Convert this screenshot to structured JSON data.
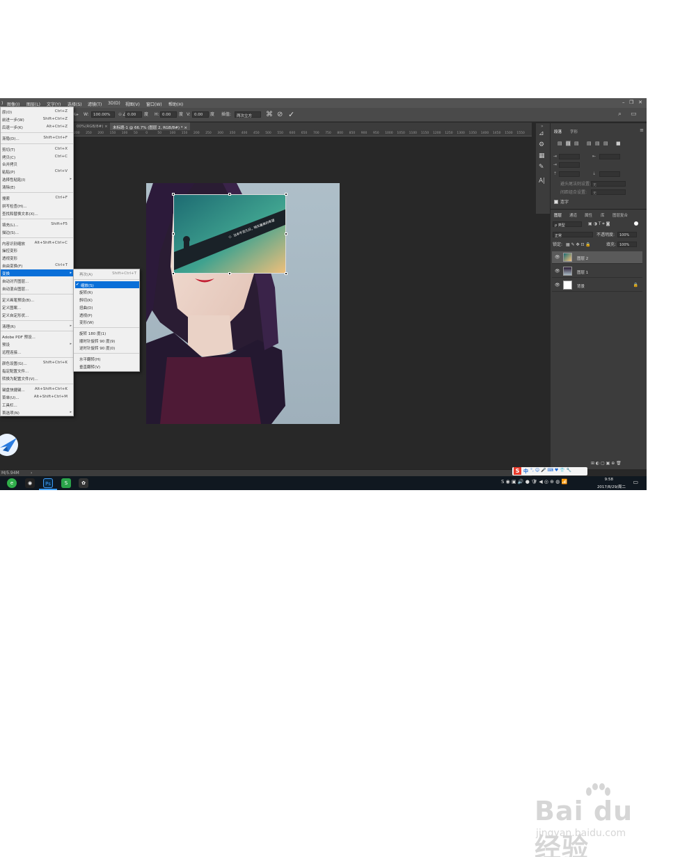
{
  "menubar": {
    "items": [
      "图像(I)",
      "图层(L)",
      "文字(Y)",
      "选择(S)",
      "滤镜(T)",
      "3D(D)",
      "视图(V)",
      "窗口(W)",
      "帮助(H)"
    ]
  },
  "optionsbar": {
    "w_label": "W:",
    "w_value": "100.00%",
    "h_label": "H:",
    "h_value": "100.00%",
    "angle_value": "0.00",
    "angle_unit": "度",
    "hskew_label": "H:",
    "hskew_value": "0.00",
    "hskew_unit": "度",
    "vskew_label": "V:",
    "vskew_value": "0.00",
    "vskew_unit": "度",
    "interp_label": "插值:",
    "interp_value": "两次立方"
  },
  "tabs": [
    {
      "label": "00%(RGB/8#)",
      "close": "×"
    },
    {
      "label": "未标题-1 @ 66.7% (图层 2, RGB/8#) *",
      "close": "×"
    }
  ],
  "ruler_ticks": [
    "200",
    "250",
    "200",
    "150",
    "100",
    "50",
    "0",
    "50",
    "100",
    "150",
    "200",
    "250",
    "300",
    "350",
    "400",
    "450",
    "500",
    "550",
    "600",
    "650",
    "700",
    "750",
    "800",
    "850",
    "900",
    "950",
    "1000",
    "1050",
    "1100",
    "1150",
    "1200",
    "1250",
    "1300",
    "1350",
    "1400",
    "1450",
    "1500",
    "1550"
  ],
  "edit_menu": {
    "items": [
      {
        "label": "原(O)",
        "shortcut": "Ctrl+Z"
      },
      {
        "label": "前进一步(W)",
        "shortcut": "Shift+Ctrl+Z"
      },
      {
        "label": "后退一步(K)",
        "shortcut": "Alt+Ctrl+Z"
      },
      {
        "sep": true
      },
      {
        "label": "渐隐(D)...",
        "shortcut": "Shift+Ctrl+F"
      },
      {
        "sep": true
      },
      {
        "label": "剪切(T)",
        "shortcut": "Ctrl+X"
      },
      {
        "label": "拷贝(C)",
        "shortcut": "Ctrl+C"
      },
      {
        "label": "合并拷贝",
        "shortcut": ""
      },
      {
        "label": "粘贴(P)",
        "shortcut": "Ctrl+V"
      },
      {
        "label": "选择性粘贴(I)",
        "shortcut": "",
        "arrow": true
      },
      {
        "label": "清除(E)",
        "shortcut": ""
      },
      {
        "sep": true
      },
      {
        "label": "搜索",
        "shortcut": "Ctrl+F"
      },
      {
        "label": "拼写检查(H)...",
        "shortcut": ""
      },
      {
        "label": "查找和替换文本(X)...",
        "shortcut": ""
      },
      {
        "sep": true
      },
      {
        "label": "填充(L)...",
        "shortcut": "Shift+F5"
      },
      {
        "label": "描边(S)...",
        "shortcut": ""
      },
      {
        "sep": true
      },
      {
        "label": "内容识别缩放",
        "shortcut": "Alt+Shift+Ctrl+C"
      },
      {
        "label": "操控变形",
        "shortcut": ""
      },
      {
        "label": "透视变形",
        "shortcut": ""
      },
      {
        "label": "自由变换(F)",
        "shortcut": "Ctrl+T"
      },
      {
        "label": "变换",
        "shortcut": "",
        "arrow": true,
        "highlight": true
      },
      {
        "label": "自动对齐图层...",
        "shortcut": ""
      },
      {
        "label": "自动混合图层...",
        "shortcut": ""
      },
      {
        "sep": true
      },
      {
        "label": "定义画笔预设(B)...",
        "shortcut": ""
      },
      {
        "label": "定义图案...",
        "shortcut": ""
      },
      {
        "label": "定义自定形状...",
        "shortcut": ""
      },
      {
        "sep": true
      },
      {
        "label": "清理(R)",
        "shortcut": "",
        "arrow": true
      },
      {
        "sep": true
      },
      {
        "label": "Adobe PDF 预设...",
        "shortcut": ""
      },
      {
        "label": "预设",
        "shortcut": "",
        "arrow": true
      },
      {
        "label": "远程连接...",
        "shortcut": ""
      },
      {
        "sep": true
      },
      {
        "label": "颜色设置(G)...",
        "shortcut": "Shift+Ctrl+K"
      },
      {
        "label": "指定配置文件...",
        "shortcut": ""
      },
      {
        "label": "转换为配置文件(V)...",
        "shortcut": ""
      },
      {
        "sep": true
      },
      {
        "label": "键盘快捷键...",
        "shortcut": "Alt+Shift+Ctrl+K"
      },
      {
        "label": "菜单(U)...",
        "shortcut": "Alt+Shift+Ctrl+M"
      },
      {
        "label": "工具栏...",
        "shortcut": ""
      },
      {
        "label": "首选项(N)",
        "shortcut": "",
        "arrow": true
      }
    ]
  },
  "transform_submenu": {
    "items": [
      {
        "label": "再次(A)",
        "shortcut": "Shift+Ctrl+T",
        "disabled": true
      },
      {
        "sep": true
      },
      {
        "label": "缩放(S)",
        "checked": true,
        "highlight": true
      },
      {
        "label": "旋转(R)"
      },
      {
        "label": "斜切(K)"
      },
      {
        "label": "扭曲(D)"
      },
      {
        "label": "透视(P)"
      },
      {
        "label": "变形(W)"
      },
      {
        "sep": true
      },
      {
        "label": "旋转 180 度(1)"
      },
      {
        "label": "顺时针旋转 90 度(9)"
      },
      {
        "label": "逆时针旋转 90 度(0)"
      },
      {
        "sep": true
      },
      {
        "label": "水平翻转(H)"
      },
      {
        "label": "垂直翻转(V)"
      }
    ]
  },
  "canvas_text": "当未平流凡日，明天最美的希望",
  "right_panel": {
    "para_tabs": [
      "段落",
      "字形"
    ],
    "hyphen_label": "连字",
    "field_labels": [
      "避头尾法则设置:",
      "间距组合设置:"
    ],
    "field_values": [
      "无",
      "无"
    ],
    "layer_tabs": [
      "图层",
      "通道",
      "属性",
      "库",
      "图层复合"
    ],
    "kind_label": "ρ 类型",
    "blend_mode": "正常",
    "opacity_label": "不透明度:",
    "opacity_value": "100%",
    "lock_label": "锁定:",
    "fill_label": "填充:",
    "fill_value": "100%",
    "layers": [
      {
        "name": "图层 2",
        "selected": true
      },
      {
        "name": "图层 1",
        "selected": false
      },
      {
        "name": "背景",
        "selected": false,
        "locked": true
      }
    ]
  },
  "statusbar": {
    "text": "M/5.94M"
  },
  "taskbar": {
    "time": "9:58",
    "date": "2017/8/29/周二"
  },
  "ime": {
    "text": "中"
  },
  "watermark": {
    "main": "Bai du 经验",
    "sub": "jingyan.baidu.com"
  }
}
